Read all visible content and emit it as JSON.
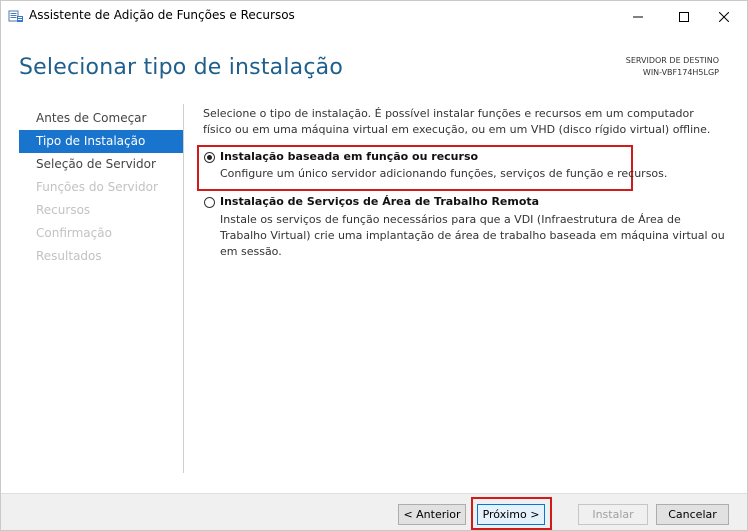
{
  "window": {
    "title": "Assistente de Adição de Funções e Recursos"
  },
  "header": {
    "page_title": "Selecionar tipo de instalação",
    "destination_label": "SERVIDOR DE DESTINO",
    "destination_server": "WIN-VBF174H5LGP"
  },
  "nav": {
    "items": [
      {
        "label": "Antes de Começar",
        "state": "normal"
      },
      {
        "label": "Tipo de Instalação",
        "state": "active"
      },
      {
        "label": "Seleção de Servidor",
        "state": "normal"
      },
      {
        "label": "Funções do Servidor",
        "state": "disabled"
      },
      {
        "label": "Recursos",
        "state": "disabled"
      },
      {
        "label": "Confirmação",
        "state": "disabled"
      },
      {
        "label": "Resultados",
        "state": "disabled"
      }
    ]
  },
  "content": {
    "intro": "Selecione o tipo de instalação. É possível instalar funções e recursos em um computador físico ou em uma máquina virtual em execução, ou em um VHD (disco rígido virtual) offline.",
    "options": [
      {
        "title": "Instalação baseada em função ou recurso",
        "description": "Configure um único servidor adicionando funções, serviços de função e recursos.",
        "selected": true
      },
      {
        "title": "Instalação de Serviços de Área de Trabalho Remota",
        "description": "Instale os serviços de função necessários para que a VDI (Infraestrutura de Área de Trabalho Virtual) crie uma implantação de área de trabalho baseada em máquina virtual ou em sessão.",
        "selected": false
      }
    ]
  },
  "footer": {
    "prev_label": "< Anterior",
    "next_label": "Próximo >",
    "install_label": "Instalar",
    "cancel_label": "Cancelar"
  },
  "colors": {
    "accent": "#1874cd",
    "title": "#1e5f8d",
    "highlight": "#d11a1a"
  },
  "icons": {
    "app": "server-manager-icon",
    "minimize": "minimize-icon",
    "maximize": "maximize-icon",
    "close": "close-icon"
  }
}
